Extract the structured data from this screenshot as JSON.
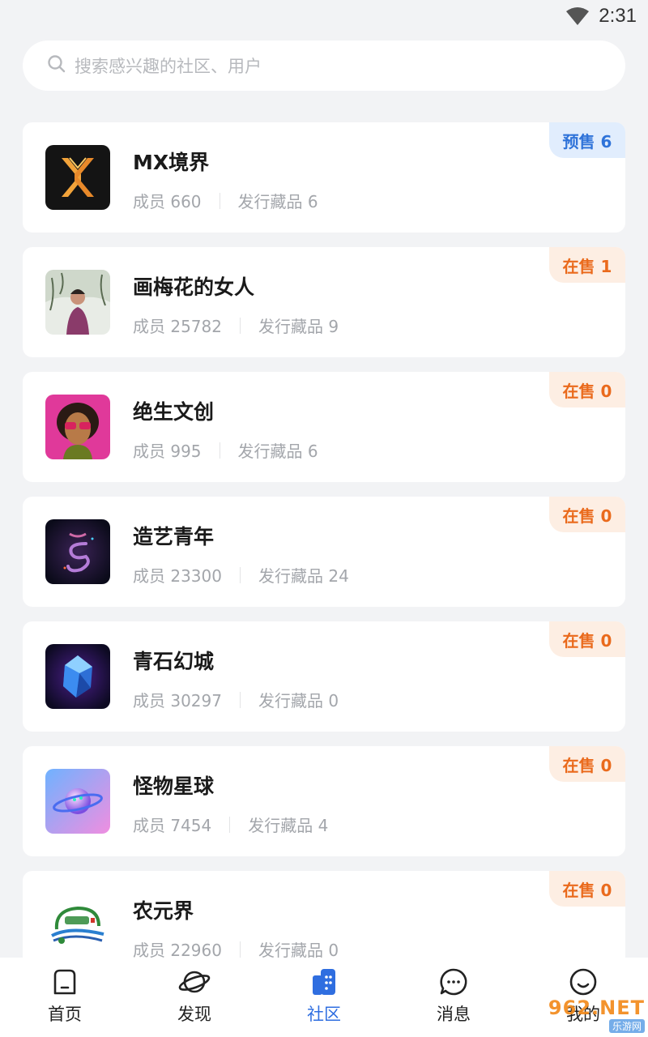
{
  "status": {
    "time": "2:31"
  },
  "search": {
    "placeholder": "搜索感兴趣的社区、用户"
  },
  "communities": [
    {
      "name": "MX境界",
      "members_label": "成员 660",
      "issued_label": "发行藏品 6",
      "badge": "预售 6",
      "badge_type": "presale",
      "icon": "mx-logo-icon"
    },
    {
      "name": "画梅花的女人",
      "members_label": "成员 25782",
      "issued_label": "发行藏品 9",
      "badge": "在售 1",
      "badge_type": "onsale",
      "icon": "portrait-woman-icon"
    },
    {
      "name": "绝生文创",
      "members_label": "成员 995",
      "issued_label": "发行藏品 6",
      "badge": "在售 0",
      "badge_type": "onsale",
      "icon": "sunglasses-woman-icon"
    },
    {
      "name": "造艺青年",
      "members_label": "成员 23300",
      "issued_label": "发行藏品 24",
      "badge": "在售 0",
      "badge_type": "onsale",
      "icon": "swirl-logo-icon"
    },
    {
      "name": "青石幻城",
      "members_label": "成员 30297",
      "issued_label": "发行藏品 0",
      "badge": "在售 0",
      "badge_type": "onsale",
      "icon": "crystal-icon"
    },
    {
      "name": "怪物星球",
      "members_label": "成员 7454",
      "issued_label": "发行藏品 4",
      "badge": "在售 0",
      "badge_type": "onsale",
      "icon": "planet-icon"
    },
    {
      "name": "农元界",
      "members_label": "成员 22960",
      "issued_label": "发行藏品 0",
      "badge": "在售 0",
      "badge_type": "onsale",
      "icon": "nongyuanjie-logo-icon"
    }
  ],
  "tabs": [
    {
      "label": "首页",
      "icon": "home-icon",
      "active": false
    },
    {
      "label": "发现",
      "icon": "planet-outline-icon",
      "active": false
    },
    {
      "label": "社区",
      "icon": "community-icon",
      "active": true
    },
    {
      "label": "消息",
      "icon": "chat-bubble-icon",
      "active": false
    },
    {
      "label": "我的",
      "icon": "smiley-icon",
      "active": false
    }
  ],
  "watermark": {
    "main": "962.NET",
    "sub": "乐游网"
  },
  "colors": {
    "accent": "#2f6ee0",
    "presale": "#2f73d9",
    "onsale": "#ea6a1c"
  }
}
